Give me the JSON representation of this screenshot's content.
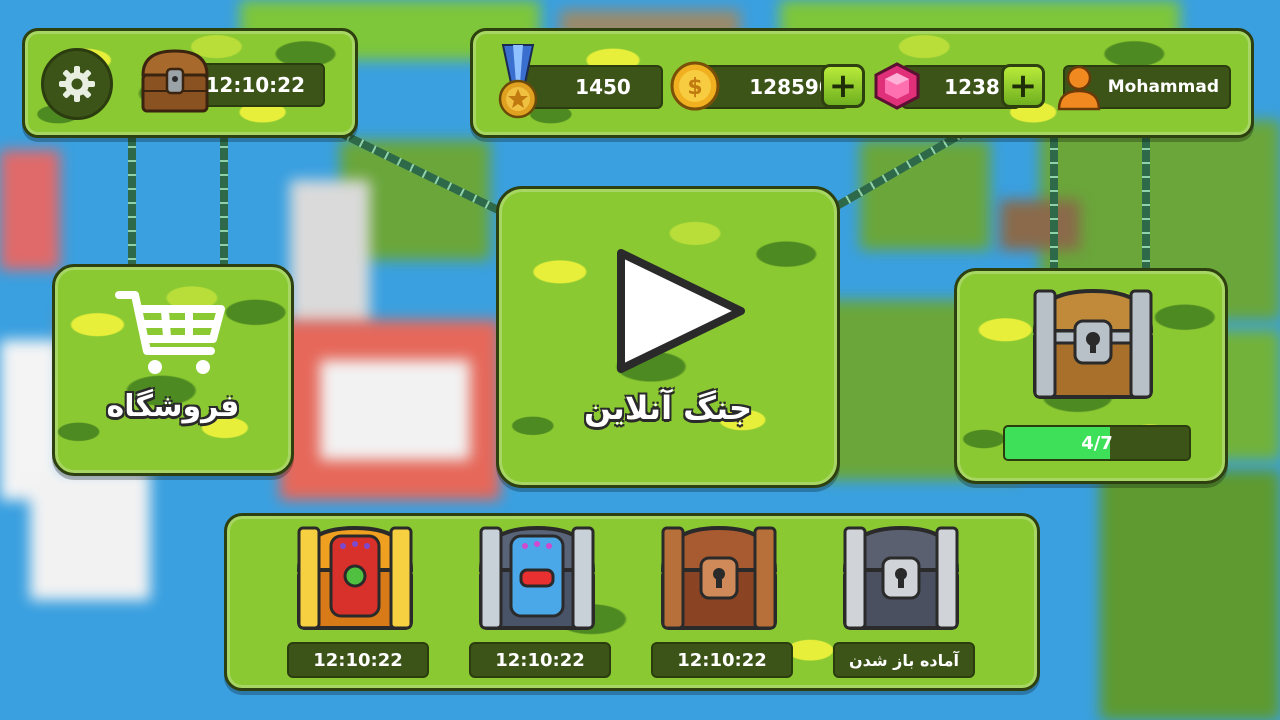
{
  "topLeft": {
    "timer": "12:10:22",
    "settings_icon": "gear-icon",
    "chest_icon": "chest-icon"
  },
  "topRight": {
    "medal_value": "1450",
    "coins_value": "128590",
    "gems_value": "1238",
    "username": "Mohammad",
    "plus_label": "+"
  },
  "shop": {
    "label": "فروشگاه",
    "icon": "shopping-cart-icon"
  },
  "battle": {
    "label": "جنگ آنلاین",
    "icon": "play-icon"
  },
  "chestProgress": {
    "text": "4/7",
    "fraction": 0.57
  },
  "chestSlots": [
    {
      "name": "gold-chest",
      "label": "12:10:22"
    },
    {
      "name": "silver-blue-chest",
      "label": "12:10:22"
    },
    {
      "name": "wooden-chest",
      "label": "12:10:22"
    },
    {
      "name": "iron-chest",
      "label": "آماده باز شدن"
    }
  ],
  "colors": {
    "camo_light": "#8bc932",
    "camo_dark": "#4e8a22",
    "camo_yellow": "#e8ef3a",
    "progress": "#3ee05a"
  }
}
